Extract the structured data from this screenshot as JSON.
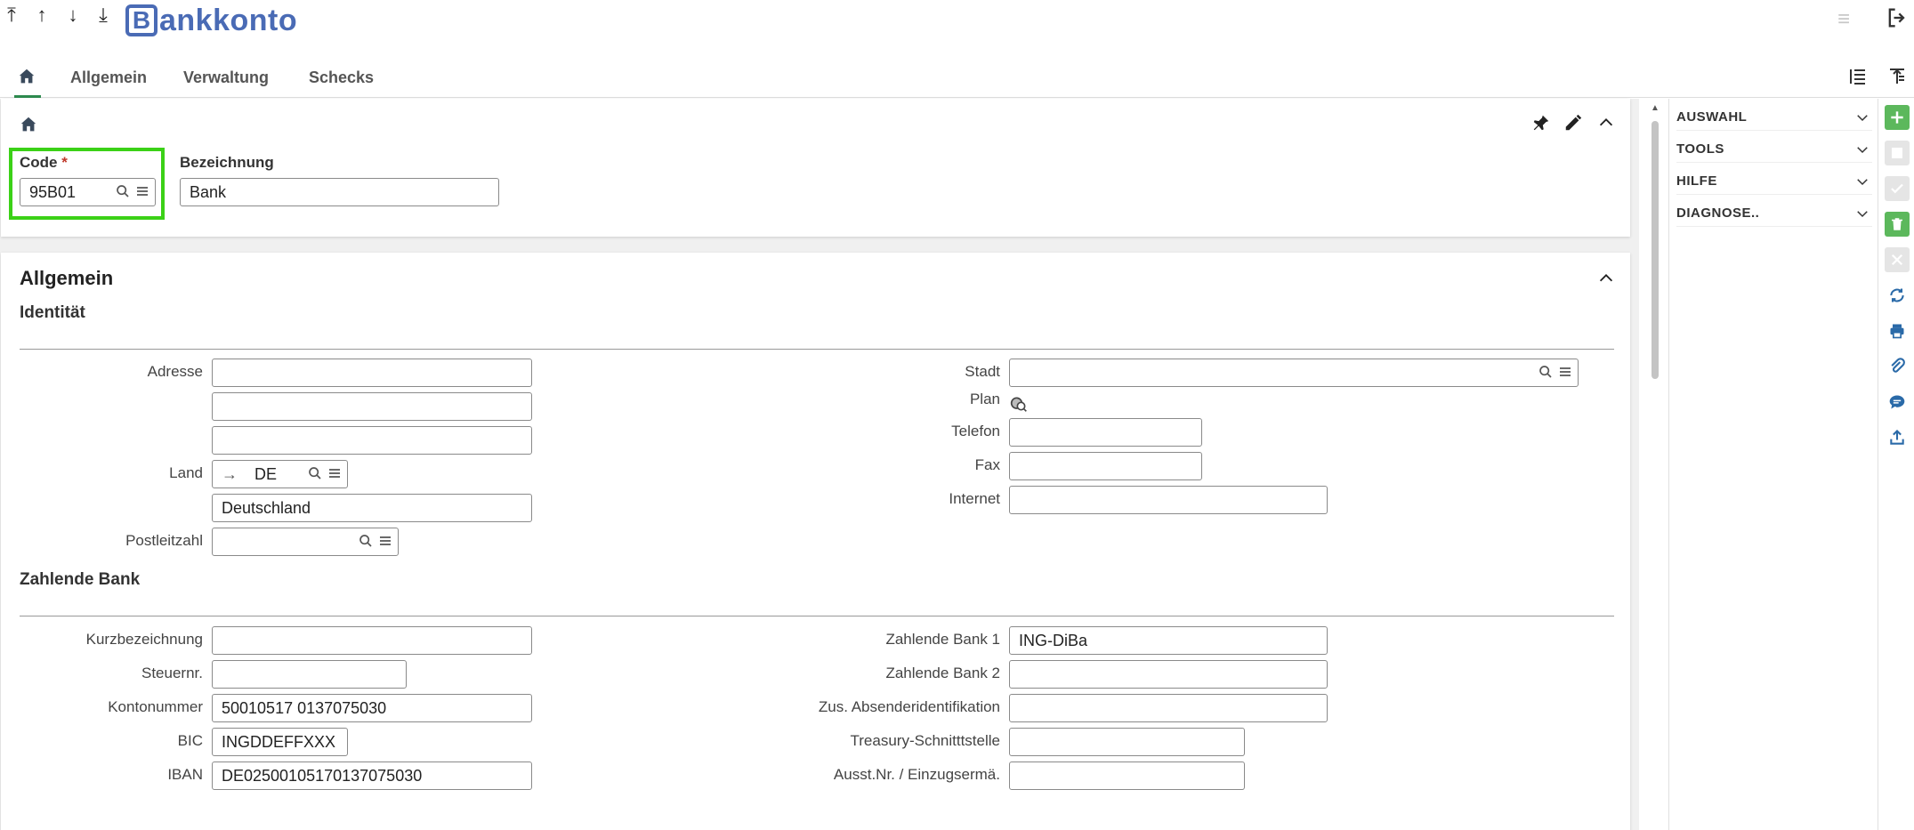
{
  "app": {
    "title_letter": "B",
    "title_rest": "ankkonto"
  },
  "tabs": [
    {
      "label": "Allgemein"
    },
    {
      "label": "Verwaltung"
    },
    {
      "label": "Schecks"
    }
  ],
  "header_card": {
    "code_label": "Code",
    "code_required": "*",
    "code_value": "95B01",
    "bezeichnung_label": "Bezeichnung",
    "bezeichnung_value": "Bank"
  },
  "allgemein": {
    "title": "Allgemein",
    "identitaet": {
      "title": "Identität",
      "adresse_label": "Adresse",
      "adresse_lines": [
        "",
        "",
        ""
      ],
      "land_label": "Land",
      "land_code": "DE",
      "land_name": "Deutschland",
      "plz_label": "Postleitzahl",
      "plz_value": "",
      "stadt_label": "Stadt",
      "stadt_value": "",
      "plan_label": "Plan",
      "telefon_label": "Telefon",
      "telefon_value": "",
      "fax_label": "Fax",
      "fax_value": "",
      "internet_label": "Internet",
      "internet_value": ""
    },
    "zahlende_bank": {
      "title": "Zahlende Bank",
      "kurz_label": "Kurzbezeichnung",
      "kurz_value": "",
      "steuer_label": "Steuernr.",
      "steuer_value": "",
      "konto_label": "Kontonummer",
      "konto_value": "50010517 0137075030",
      "bic_label": "BIC",
      "bic_value": "INGDDEFFXXX",
      "iban_label": "IBAN",
      "iban_value": "DE02500105170137075030",
      "zb1_label": "Zahlende Bank 1",
      "zb1_value": "ING-DiBa",
      "zb2_label": "Zahlende Bank 2",
      "zb2_value": "",
      "zus_label": "Zus. Absenderidentifikation",
      "zus_value": "",
      "treasury_label": "Treasury-Schnitttstelle",
      "treasury_value": "",
      "ausst_label": "Ausst.Nr. / Einzugsermä.",
      "ausst_value": ""
    }
  },
  "right_panel": {
    "items": [
      {
        "label": "AUSWAHL"
      },
      {
        "label": "TOOLS"
      },
      {
        "label": "HILFE"
      },
      {
        "label": "DIAGNOSE.."
      }
    ]
  },
  "colors": {
    "brand": "#4a6bb5",
    "highlight": "#3bd117",
    "add_green": "#5cb85c"
  }
}
